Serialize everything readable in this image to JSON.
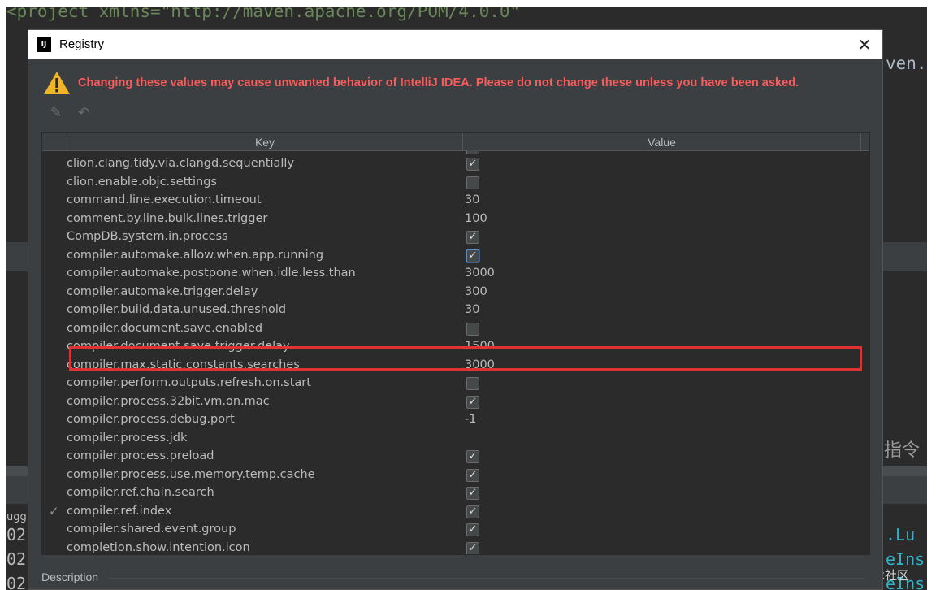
{
  "ide": {
    "code_line": "<project xmlns=\"http://maven.apache.org/POM/4.0.0\"",
    "right_fragment": "ven.",
    "chinese_fragment": "指令",
    "left_fragment": "ugg",
    "console_left": [
      "02",
      "02",
      "02"
    ],
    "console_right": [
      ".Lu",
      "eIns",
      "eIns"
    ],
    "watermark": "@稀土掘金技术社区"
  },
  "dialog": {
    "logo_text": "IJ",
    "title": "Registry",
    "close_glyph": "✕",
    "warning": "Changing these values may cause unwanted behavior of IntelliJ IDEA. Please do not change these unless you have been asked.",
    "toolbar": {
      "edit_glyph": "✎",
      "revert_glyph": "↶"
    },
    "columns": {
      "key": "Key",
      "value": "Value"
    },
    "rows": [
      {
        "key": "clion.clang.tidy.via.clangd.sequentially",
        "type": "checkbox",
        "checked": "✓"
      },
      {
        "key": "clion.enable.objc.settings",
        "type": "checkbox",
        "checked": ""
      },
      {
        "key": "command.line.execution.timeout",
        "type": "text",
        "value": "30"
      },
      {
        "key": "comment.by.line.bulk.lines.trigger",
        "type": "text",
        "value": "100"
      },
      {
        "key": "CompDB.system.in.process",
        "type": "checkbox",
        "checked": "✓"
      },
      {
        "key": "compiler.automake.allow.when.app.running",
        "type": "checkbox",
        "checked": "✓",
        "selected": true
      },
      {
        "key": "compiler.automake.postpone.when.idle.less.than",
        "type": "text",
        "value": "3000"
      },
      {
        "key": "compiler.automake.trigger.delay",
        "type": "text",
        "value": "300"
      },
      {
        "key": "compiler.build.data.unused.threshold",
        "type": "text",
        "value": "30"
      },
      {
        "key": "compiler.document.save.enabled",
        "type": "checkbox",
        "checked": ""
      },
      {
        "key": "compiler.document.save.trigger.delay",
        "type": "text",
        "value": "1500"
      },
      {
        "key": "compiler.max.static.constants.searches",
        "type": "text",
        "value": "3000"
      },
      {
        "key": "compiler.perform.outputs.refresh.on.start",
        "type": "checkbox",
        "checked": ""
      },
      {
        "key": "compiler.process.32bit.vm.on.mac",
        "type": "checkbox",
        "checked": "✓"
      },
      {
        "key": "compiler.process.debug.port",
        "type": "text",
        "value": "-1"
      },
      {
        "key": "compiler.process.jdk",
        "type": "text",
        "value": ""
      },
      {
        "key": "compiler.process.preload",
        "type": "checkbox",
        "checked": "✓"
      },
      {
        "key": "compiler.process.use.memory.temp.cache",
        "type": "checkbox",
        "checked": "✓"
      },
      {
        "key": "compiler.ref.chain.search",
        "type": "checkbox",
        "checked": "✓"
      },
      {
        "key": "compiler.ref.index",
        "type": "checkbox",
        "checked": "✓",
        "marker": "✓"
      },
      {
        "key": "compiler.shared.event.group",
        "type": "checkbox",
        "checked": "✓"
      },
      {
        "key": "completion.show.intention.icon",
        "type": "checkbox",
        "checked": "✓"
      }
    ],
    "description_label": "Description"
  },
  "colors": {
    "warning_text": "#ff5a5a",
    "highlight_border": "#e03232",
    "dialog_bg": "#3c3f41",
    "table_bg": "#2b2b2b"
  }
}
